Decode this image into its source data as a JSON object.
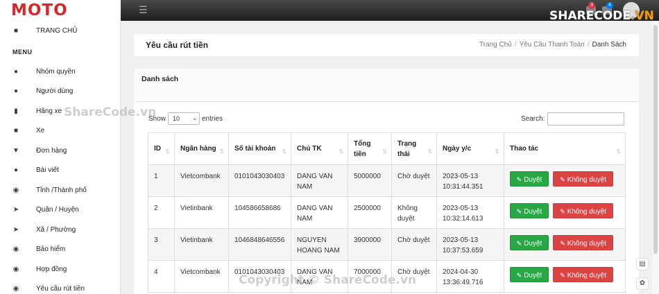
{
  "app": {
    "logo": "MOTO"
  },
  "topbar": {
    "hamburger_icon": "menu-icon",
    "badges": [
      {
        "count": "3",
        "color": "#dc3545",
        "icon": "bell-icon"
      },
      {
        "count": "4",
        "color": "#007bff",
        "icon": "mail-icon"
      }
    ]
  },
  "sidebar": {
    "home": {
      "label": "TRANG CHỦ",
      "icon": "car-icon"
    },
    "menu_heading": "MENU",
    "items": [
      {
        "label": "Nhóm quyền",
        "icon": "users-icon"
      },
      {
        "label": "Người dùng",
        "icon": "user-icon"
      },
      {
        "label": "Hãng xe",
        "icon": "book-icon"
      },
      {
        "label": "Xe",
        "icon": "car-icon"
      },
      {
        "label": "Đơn hàng",
        "icon": "cart-icon"
      },
      {
        "label": "Bài viết",
        "icon": "user-icon"
      },
      {
        "label": "Tỉnh /Thành phố",
        "icon": "map-pin-icon"
      },
      {
        "label": "Quận / Huyện",
        "icon": "location-arrow-icon"
      },
      {
        "label": "Xã / Phường",
        "icon": "location-arrow-icon"
      },
      {
        "label": "Bảo hiểm",
        "icon": "eye-icon"
      },
      {
        "label": "Hợp đồng",
        "icon": "eye-icon"
      },
      {
        "label": "Yêu cầu rút tiền",
        "icon": "eye-icon"
      }
    ]
  },
  "header": {
    "title": "Yêu cầu rút tiền",
    "breadcrumb": [
      "Trang Chủ",
      "Yêu Cầu Thanh Toán",
      "Danh Sách"
    ]
  },
  "list": {
    "card_title": "Danh sách",
    "show_label": "Show",
    "page_size": "10",
    "entries_label": "entries",
    "search_label": "Search:",
    "search_value": "",
    "columns": [
      "ID",
      "Ngân hàng",
      "Số tài khoản",
      "Chủ TK",
      "Tổng tiền",
      "Trạng thái",
      "Ngày y/c",
      "Thao tác"
    ],
    "approve_label": "Duyệt",
    "reject_label": "Không duyệt",
    "rows": [
      {
        "id": "1",
        "bank": "Vietcombank",
        "account": "0101043030403",
        "owner": "DANG VAN NAM",
        "amount": "5000000",
        "status": "Chờ duyệt",
        "date": "2023-05-13 10:31:44.351"
      },
      {
        "id": "2",
        "bank": "Vietinbank",
        "account": "104586658686",
        "owner": "DANG VAN NAM",
        "amount": "2500000",
        "status": "Không duyệt",
        "date": "2023-05-13 10:32:14.613"
      },
      {
        "id": "3",
        "bank": "Vietinbank",
        "account": "1046848646556",
        "owner": "NGUYEN HOANG NAM",
        "amount": "3900000",
        "status": "Chờ duyệt",
        "date": "2023-05-13 10:37:53.659"
      },
      {
        "id": "4",
        "bank": "Vietcombank",
        "account": "0101043030403",
        "owner": "DANG VAN NAM",
        "amount": "7000000",
        "status": "Chờ duyệt",
        "date": "2024-04-30 13:36:49.716"
      }
    ]
  },
  "watermarks": {
    "sidebar": "ShareCode.vn",
    "footer": "Copyright © ShareCode.vn",
    "brand_main": "SHARECODE",
    "brand_suffix": ".VN"
  },
  "colors": {
    "brand": "#d62828",
    "approve": "#28a745",
    "reject": "#dc4444"
  }
}
